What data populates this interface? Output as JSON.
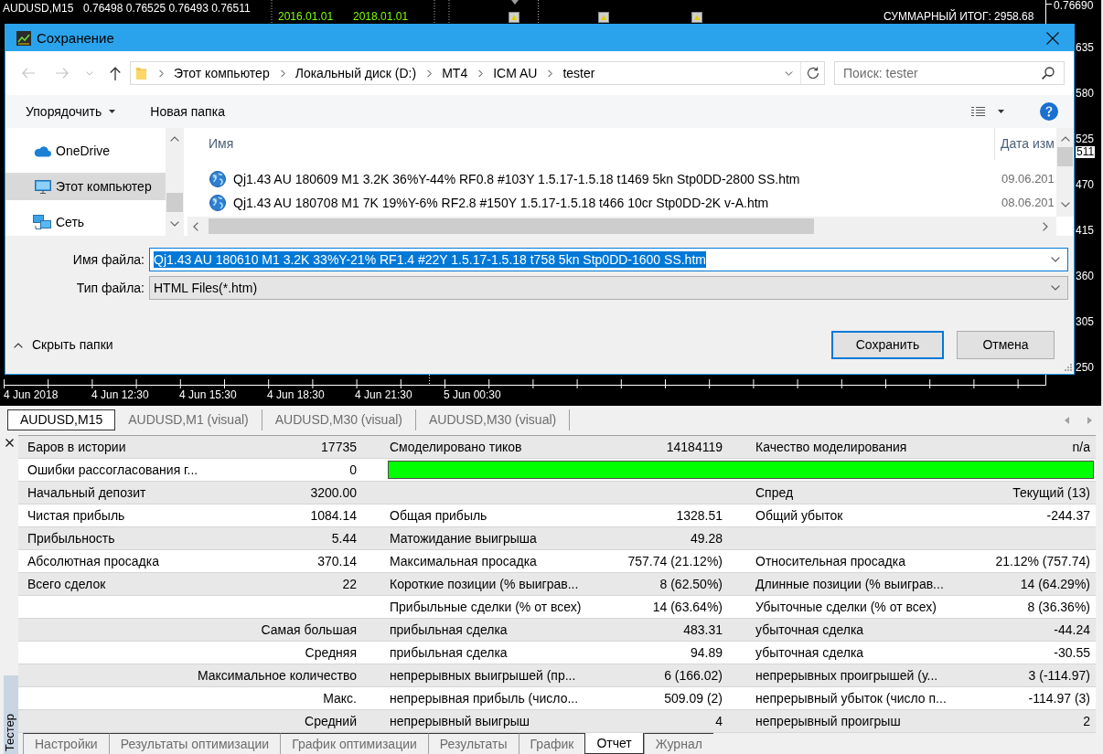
{
  "chart": {
    "symbol": "AUDUSD,M15",
    "quote": "0.76498 0.76525 0.76493 0.76511",
    "period_labels": [
      "2016.01.01",
      "2018.01.01"
    ],
    "summary": "СУММАРНЫЙ ИТОГ: 2958.68",
    "price_labels": [
      {
        "text": "0.76690",
        "kind": "tick"
      },
      {
        "text": "635",
        "kind": "tick"
      },
      {
        "text": "580",
        "kind": "tick"
      },
      {
        "text": "525",
        "kind": "tick"
      },
      {
        "text": "511",
        "kind": "current"
      },
      {
        "text": "470",
        "kind": "tick"
      },
      {
        "text": "415",
        "kind": "tick"
      },
      {
        "text": "360",
        "kind": "tick"
      },
      {
        "text": "305",
        "kind": "tick"
      },
      {
        "text": "250",
        "kind": "tick"
      }
    ],
    "time_labels": [
      "4 Jun 2018",
      "4 Jun 12:30",
      "4 Jun 15:30",
      "4 Jun 18:30",
      "4 Jun 21:30",
      "5 Jun 00:30"
    ]
  },
  "dialog": {
    "title": "Сохранение",
    "address": [
      "Этот компьютер",
      "Локальный диск (D:)",
      "MT4",
      "ICM AU",
      "tester"
    ],
    "search": {
      "placeholder": "Поиск: tester"
    },
    "toolbar": {
      "organize": "Упорядочить",
      "new_folder": "Новая папка"
    },
    "nav": [
      {
        "label": "OneDrive",
        "selected": false
      },
      {
        "label": "Этот компьютер",
        "selected": true
      },
      {
        "label": "Сеть",
        "selected": false
      }
    ],
    "files": {
      "columns": [
        "Имя",
        "Дата изм"
      ],
      "rows": [
        {
          "name": "Qj1.43 AU 180609 M1 3.2K 36%Y-44% RF0.8 #103Y 1.5.17-1.5.18 t1469 5kn Stp0DD-2800 SS.htm",
          "date": "09.06.201"
        },
        {
          "name": "Qj1.43 AU 180708 M1 7K 19%Y-6% RF2.8 #150Y 1.5.17-1.5.18 t466 10cr Stp0DD-2K v-A.htm",
          "date": "08.06.201"
        }
      ]
    },
    "file_name": {
      "label": "Имя файла:",
      "value": "Qj1.43 AU 180610 M1 3.2K 33%Y-21% RF1.4 #22Y 1.5.17-1.5.18 t758 5kn Stp0DD-1600 SS.htm",
      "text_selected": true
    },
    "file_type": {
      "label": "Тип файла:",
      "value": "HTML Files(*.htm)"
    },
    "hide_folders": "Скрыть папки",
    "buttons": [
      {
        "label": "Сохранить",
        "default": true
      },
      {
        "label": "Отмена",
        "default": false
      }
    ]
  },
  "chart_tabs": [
    {
      "label": "AUDUSD,M15",
      "selected": true
    },
    {
      "label": "AUDUSD,M1 (visual)",
      "selected": false
    },
    {
      "label": "AUDUSD,M30 (visual)",
      "selected": false
    },
    {
      "label": "AUDUSD,M30 (visual)",
      "selected": false
    }
  ],
  "tester": {
    "side_label": "Тестер",
    "report": [
      {
        "kind": "stats",
        "label_1": "Баров в истории",
        "value_1": "17735",
        "label_2": "Смоделировано тиков",
        "value_2": "14184119",
        "label_3": "Качество моделирования",
        "value_3": "n/a"
      },
      {
        "kind": "quality",
        "label_1": "Ошибки рассогласования г...",
        "value_1": "0",
        "quality_bar": {
          "level": 1
        }
      },
      {
        "kind": "stats",
        "label_1": "Начальный депозит",
        "value_1": "3200.00",
        "label_3": "Спред",
        "value_3": "Текущий (13)"
      },
      {
        "kind": "stats",
        "label_1": "Чистая прибыль",
        "value_1": "1084.14",
        "label_2": "Общая прибыль",
        "value_2": "1328.51",
        "label_3": "Общий убыток",
        "value_3": "-244.37"
      },
      {
        "kind": "stats",
        "label_1": "Прибыльность",
        "value_1": "5.44",
        "label_2": "Матожидание выигрыша",
        "value_2": "49.28"
      },
      {
        "kind": "stats",
        "label_1": "Абсолютная просадка",
        "value_1": "370.14",
        "label_2": "Максимальная просадка",
        "value_2": "757.74 (21.12%)",
        "label_3": "Относительная просадка",
        "value_3": "21.12% (757.74)"
      },
      {
        "kind": "stats",
        "label_1": "Всего сделок",
        "value_1": "22",
        "label_2": "Короткие позиции (% выиграв...",
        "value_2": "8 (62.50%)",
        "label_3": "Длинные позиции (% выиграв...",
        "value_3": "14 (64.29%)"
      },
      {
        "kind": "stats",
        "label_2": "Прибыльные сделки (% от всех)",
        "value_2": "14 (63.64%)",
        "label_3": "Убыточные сделки (% от всех)",
        "value_3": "8 (36.36%)"
      },
      {
        "kind": "group",
        "label_1": "Самая большая",
        "label_2": "прибыльная сделка",
        "value_2": "483.31",
        "label_3": "убыточная сделка",
        "value_3": "-44.24"
      },
      {
        "kind": "group",
        "label_1": "Средняя",
        "label_2": "прибыльная сделка",
        "value_2": "94.89",
        "label_3": "убыточная сделка",
        "value_3": "-30.55"
      },
      {
        "kind": "group",
        "label_1": "Максимальное количество",
        "label_2": "непрерывных выигрышей (пр...",
        "value_2": "6 (166.02)",
        "label_3": "непрерывных проигрышей (у...",
        "value_3": "3 (-114.97)"
      },
      {
        "kind": "group",
        "label_1": "Макс.",
        "label_2": "непрерывная прибыль (число...",
        "value_2": "509.09 (2)",
        "label_3": "непрерывный убыток (число п...",
        "value_3": "-114.97 (3)"
      },
      {
        "kind": "group",
        "label_1": "Средний",
        "label_2": "непрерывный выигрыш",
        "value_2": "4",
        "label_3": "непрерывный проигрыш",
        "value_3": "2"
      }
    ],
    "tabs": [
      {
        "label": "Настройки",
        "selected": false
      },
      {
        "label": "Результаты оптимизации",
        "selected": false
      },
      {
        "label": "График оптимизации",
        "selected": false
      },
      {
        "label": "Результаты",
        "selected": false
      },
      {
        "label": "График",
        "selected": false
      },
      {
        "label": "Отчет",
        "selected": true
      },
      {
        "label": "Журнал",
        "selected": false
      }
    ]
  }
}
